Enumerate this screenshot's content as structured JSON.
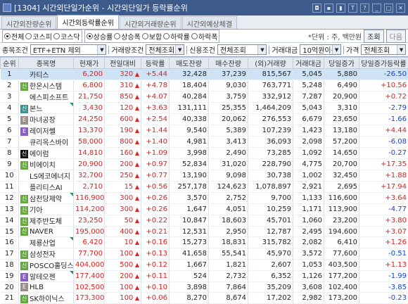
{
  "window": {
    "title": "[1304] 시간외단일가순위 - 시간외단일가 등락률순위",
    "icons": [
      "window-icon",
      "pin-icon",
      "link-icon",
      "notes-icon",
      "font-icon",
      "help-icon",
      "minimize-icon",
      "maximize-icon",
      "close-icon"
    ],
    "icon_glyphs": [
      "▣",
      "◘",
      "▪",
      "▮",
      "T",
      "?",
      "_",
      "□",
      "✕"
    ]
  },
  "tabs": [
    {
      "label": "시간외잔량순위",
      "active": false
    },
    {
      "label": "시간외등락률순위",
      "active": true
    },
    {
      "label": "시간외거래량순위",
      "active": false
    },
    {
      "label": "시간외예상체결",
      "active": false
    }
  ],
  "market_filter": [
    {
      "label": "전체",
      "selected": true
    },
    {
      "label": "코스피",
      "selected": false
    },
    {
      "label": "코스닥",
      "selected": false
    }
  ],
  "rank_type": [
    {
      "label": "상승률",
      "selected": true
    },
    {
      "label": "상승폭",
      "selected": false
    },
    {
      "label": "보합",
      "selected": false
    },
    {
      "label": "하락률",
      "selected": false
    },
    {
      "label": "하락폭",
      "selected": false
    }
  ],
  "unit_text": "*단위 : 주, 백만원",
  "buttons": {
    "query": "조회",
    "next": "다음"
  },
  "filters": [
    {
      "label": "종목조건",
      "value": "ETF+ETN 제외",
      "width": 111
    },
    {
      "label": "거래량조건",
      "value": "전체조회",
      "width": 56
    },
    {
      "label": "신용조건",
      "value": "전체조회",
      "width": 72
    },
    {
      "label": "거래대금",
      "value": "10억원이상",
      "width": 60
    },
    {
      "label": "가격",
      "value": "전체조회",
      "width": 65
    }
  ],
  "columns": [
    "순위",
    "종목명",
    "현재가",
    "전일대비",
    "등락률",
    "매도잔량",
    "매수잔량",
    "(외)거래량",
    "거래대금",
    "당일증가",
    "당일증가등락률"
  ],
  "rows": [
    {
      "rank": "1",
      "badge": "",
      "badge_color": "none",
      "name": "카티스",
      "price": "6,200",
      "change": "320",
      "rate": "+5.44",
      "ask": "32,428",
      "bid": "37,239",
      "volume": "815,567",
      "amount": "5,045",
      "day_price": "5,880",
      "day_rate": "-26.50",
      "day_dir": "down",
      "selected": true,
      "flag": false
    },
    {
      "rank": "2",
      "badge": "신",
      "badge_color": "green",
      "name": "한온시스템",
      "price": "6,800",
      "change": "310",
      "rate": "+4.78",
      "ask": "18,404",
      "bid": "9,030",
      "volume": "763,771",
      "amount": "5,248",
      "day_price": "6,490",
      "day_rate": "+10.56",
      "day_dir": "up",
      "selected": false,
      "flag": false
    },
    {
      "rank": "3",
      "badge": "",
      "badge_color": "none",
      "name": "에스피소프트",
      "price": "21,750",
      "change": "850",
      "rate": "+4.07",
      "ask": "40,284",
      "bid": "3,759",
      "volume": "332,912",
      "amount": "7,287",
      "day_price": "20,900",
      "day_rate": "+0.72",
      "day_dir": "up",
      "selected": false,
      "flag": false
    },
    {
      "rank": "4",
      "badge": "신",
      "badge_color": "teal",
      "name": "본느",
      "price": "3,430",
      "change": "120",
      "rate": "+3.63",
      "ask": "131,111",
      "bid": "25,355",
      "volume": "1,464,209",
      "amount": "5,043",
      "day_price": "3,310",
      "day_rate": "-2.79",
      "day_dir": "down",
      "selected": false,
      "flag": true
    },
    {
      "rank": "5",
      "badge": "E",
      "badge_color": "grey",
      "name": "마녀공장",
      "price": "24,250",
      "change": "600",
      "rate": "+2.54",
      "ask": "40,338",
      "bid": "20,062",
      "volume": "276,553",
      "amount": "6,679",
      "day_price": "23,650",
      "day_rate": "-1.66",
      "day_dir": "down",
      "selected": false,
      "flag": false
    },
    {
      "rank": "6",
      "badge": "E",
      "badge_color": "purple",
      "name": "레이저쎌",
      "price": "13,370",
      "change": "190",
      "rate": "+1.44",
      "ask": "9,540",
      "bid": "5,389",
      "volume": "107,239",
      "amount": "1,423",
      "day_price": "13,180",
      "day_rate": "+4.44",
      "day_dir": "up",
      "selected": false,
      "flag": false
    },
    {
      "rank": "7",
      "badge": "",
      "badge_color": "none",
      "name": "큐리옥스바이",
      "price": "58,000",
      "change": "800",
      "rate": "+1.40",
      "ask": "4,981",
      "bid": "3,413",
      "volume": "36,093",
      "amount": "2,098",
      "day_price": "57,200",
      "day_rate": "-6.08",
      "day_dir": "down",
      "selected": false,
      "flag": false
    },
    {
      "rank": "8",
      "badge": "신",
      "badge_color": "black",
      "name": "에이럼",
      "price": "14,810",
      "change": "160",
      "rate": "+1.09",
      "ask": "3,998",
      "bid": "2,490",
      "volume": "73,285",
      "amount": "1,092",
      "day_price": "14,650",
      "day_rate": "-0.27",
      "day_dir": "down",
      "selected": false,
      "flag": false
    },
    {
      "rank": "9",
      "badge": "신",
      "badge_color": "green",
      "name": "비에이치",
      "price": "20,900",
      "change": "200",
      "rate": "+0.97",
      "ask": "52,834",
      "bid": "31,020",
      "volume": "228,790",
      "amount": "4,775",
      "day_price": "20,700",
      "day_rate": "+17.35",
      "day_dir": "up",
      "selected": false,
      "flag": false
    },
    {
      "rank": "10",
      "badge": "",
      "badge_color": "none",
      "name": "LS에코에너지",
      "price": "32,700",
      "change": "250",
      "rate": "+0.77",
      "ask": "13,190",
      "bid": "9,098",
      "volume": "30,738",
      "amount": "1,002",
      "day_price": "32,450",
      "day_rate": "+1.88",
      "day_dir": "up",
      "selected": false,
      "flag": false
    },
    {
      "rank": "11",
      "badge": "",
      "badge_color": "none",
      "name": "플리티스AI",
      "price": "2,710",
      "change": "15",
      "rate": "+0.56",
      "ask": "257,178",
      "bid": "124,623",
      "volume": "1,078,897",
      "amount": "2,921",
      "day_price": "2,695",
      "day_rate": "+17.94",
      "day_dir": "up",
      "selected": false,
      "flag": false
    },
    {
      "rank": "12",
      "badge": "신",
      "badge_color": "green",
      "name": "삼천당제약",
      "price": "116,900",
      "change": "300",
      "rate": "+0.26",
      "ask": "3,570",
      "bid": "2,752",
      "volume": "9,700",
      "amount": "1,133",
      "day_price": "116,600",
      "day_rate": "+3.64",
      "day_dir": "up",
      "selected": false,
      "flag": true
    },
    {
      "rank": "13",
      "badge": "신",
      "badge_color": "green",
      "name": "기아",
      "price": "114,200",
      "change": "300",
      "rate": "+0.26",
      "ask": "1,647",
      "bid": "4,051",
      "volume": "10,259",
      "amount": "1,171",
      "day_price": "113,900",
      "day_rate": "-4.77",
      "day_dir": "down",
      "selected": false,
      "flag": false
    },
    {
      "rank": "14",
      "badge": "신",
      "badge_color": "green",
      "name": "제주반도체",
      "price": "23,250",
      "change": "50",
      "rate": "+0.22",
      "ask": "10,847",
      "bid": "18,603",
      "volume": "45,701",
      "amount": "1,060",
      "day_price": "23,200",
      "day_rate": "+3.80",
      "day_dir": "up",
      "selected": false,
      "flag": false
    },
    {
      "rank": "15",
      "badge": "신",
      "badge_color": "green",
      "name": "NAVER",
      "price": "195,000",
      "change": "400",
      "rate": "+0.21",
      "ask": "12,531",
      "bid": "2,950",
      "volume": "12,787",
      "amount": "2,495",
      "day_price": "194,600",
      "day_rate": "+3.07",
      "day_dir": "up",
      "selected": false,
      "flag": false
    },
    {
      "rank": "16",
      "badge": "",
      "badge_color": "none",
      "name": "제룡산업",
      "price": "6,420",
      "change": "10",
      "rate": "+0.16",
      "ask": "15,273",
      "bid": "18,831",
      "volume": "315,782",
      "amount": "2,082",
      "day_price": "6,410",
      "day_rate": "+1.26",
      "day_dir": "up",
      "selected": false,
      "flag": true
    },
    {
      "rank": "17",
      "badge": "신",
      "badge_color": "green",
      "name": "삼성전자",
      "price": "77,700",
      "change": "100",
      "rate": "+0.13",
      "ask": "41,658",
      "bid": "55,541",
      "volume": "45,970",
      "amount": "3,572",
      "day_price": "77,600",
      "day_rate": "-0.51",
      "day_dir": "down",
      "selected": false,
      "flag": false
    },
    {
      "rank": "18",
      "badge": "신",
      "badge_color": "green",
      "name": "POSCO홀딩스",
      "price": "404,000",
      "change": "500",
      "rate": "+0.12",
      "ask": "1,667",
      "bid": "1,821",
      "volume": "2,607",
      "amount": "1,053",
      "day_price": "403,500",
      "day_rate": "+1.13",
      "day_dir": "up",
      "selected": false,
      "flag": false
    },
    {
      "rank": "19",
      "badge": "E",
      "badge_color": "purple",
      "name": "알테오젠",
      "price": "177,400",
      "change": "200",
      "rate": "+0.11",
      "ask": "524",
      "bid": "2,732",
      "volume": "6,352",
      "amount": "1,126",
      "day_price": "177,200",
      "day_rate": "-1.99",
      "day_dir": "down",
      "selected": false,
      "flag": true
    },
    {
      "rank": "20",
      "badge": "E",
      "badge_color": "grey",
      "name": "HLB",
      "price": "102,500",
      "change": "100",
      "rate": "+0.10",
      "ask": "3,898",
      "bid": "7,864",
      "volume": "35,209",
      "amount": "3,608",
      "day_price": "102,400",
      "day_rate": "-3.85",
      "day_dir": "down",
      "selected": false,
      "flag": false
    },
    {
      "rank": "21",
      "badge": "신",
      "badge_color": "green",
      "name": "SK하이닉스",
      "price": "173,300",
      "change": "100",
      "rate": "+0.06",
      "ask": "8,270",
      "bid": "8,674",
      "volume": "17,202",
      "amount": "2,982",
      "day_price": "173,200",
      "day_rate": "-0.23",
      "day_dir": "down",
      "selected": false,
      "flag": false
    }
  ],
  "colors": {
    "up": "#e0201c",
    "down": "#1044d8",
    "titlebar": "#3d5a8c",
    "selected_row": "#cfe3f7"
  }
}
